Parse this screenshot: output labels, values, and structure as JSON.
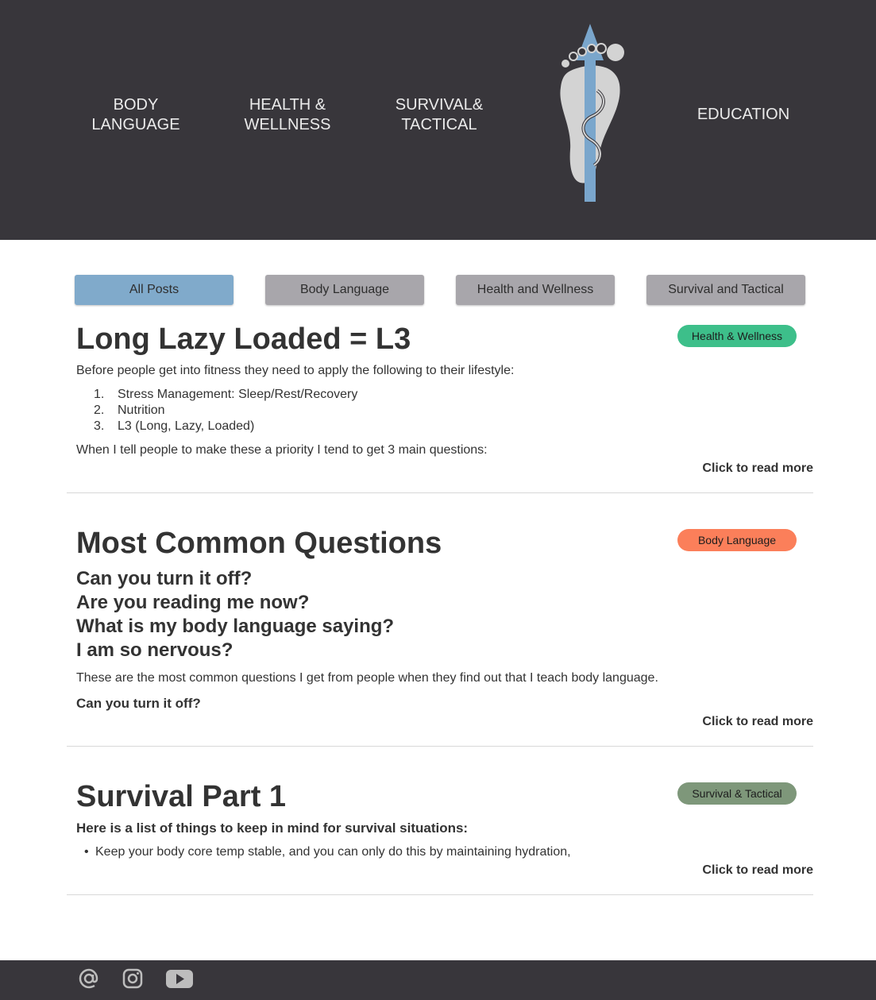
{
  "nav": {
    "item1": "BODY\nLANGUAGE",
    "item2": "HEALTH &\nWELLNESS",
    "item3": "SURVIVAL&\nTACTICAL",
    "item4": "EDUCATION",
    "logo_icon": "footprint-caduceus-logo"
  },
  "filters": {
    "all": "All Posts",
    "body": "Body Language",
    "health": "Health and Wellness",
    "survival": "Survival and Tactical",
    "active": "all",
    "active_color": "#80aacb",
    "inactive_color": "#a8a6ab"
  },
  "posts": [
    {
      "title": "Long Lazy Loaded = L3",
      "tag": "Health & Wellness",
      "tag_color": "#3dbf8a",
      "intro": "Before people get into fitness they need to apply the following to their lifestyle:",
      "list": [
        {
          "num": "1.",
          "text": "Stress Management: Sleep/Rest/Recovery"
        },
        {
          "num": "2.",
          "text": "Nutrition"
        },
        {
          "num": "3.",
          "text": "L3 (Long, Lazy, Loaded)"
        }
      ],
      "outro": "When I tell people to make these a priority I tend to get 3 main questions:",
      "read_more": "Click to read more"
    },
    {
      "title": "Most Common Questions",
      "tag": "Body Language",
      "tag_color": "#fb7f5a",
      "questions": [
        "Can you turn it off?",
        "Are you reading me now?",
        "What is my body language saying?",
        "I am so nervous?"
      ],
      "text": "These are the most common questions I get from people when they find out that I teach body language.",
      "subheading": "Can you turn it off?",
      "read_more": "Click to read more"
    },
    {
      "title": "Survival Part 1",
      "tag": "Survival & Tactical",
      "tag_color": "#7e977a",
      "subheading": "Here is a list of things to keep in mind for survival situations:",
      "bullet": "Keep your body core temp stable, and you can only do this by maintaining hydration,",
      "read_more": "Click to read more"
    }
  ],
  "footer": {
    "icons": [
      "at-icon",
      "instagram-icon",
      "youtube-icon"
    ],
    "icon_color": "#bdbdbd"
  }
}
